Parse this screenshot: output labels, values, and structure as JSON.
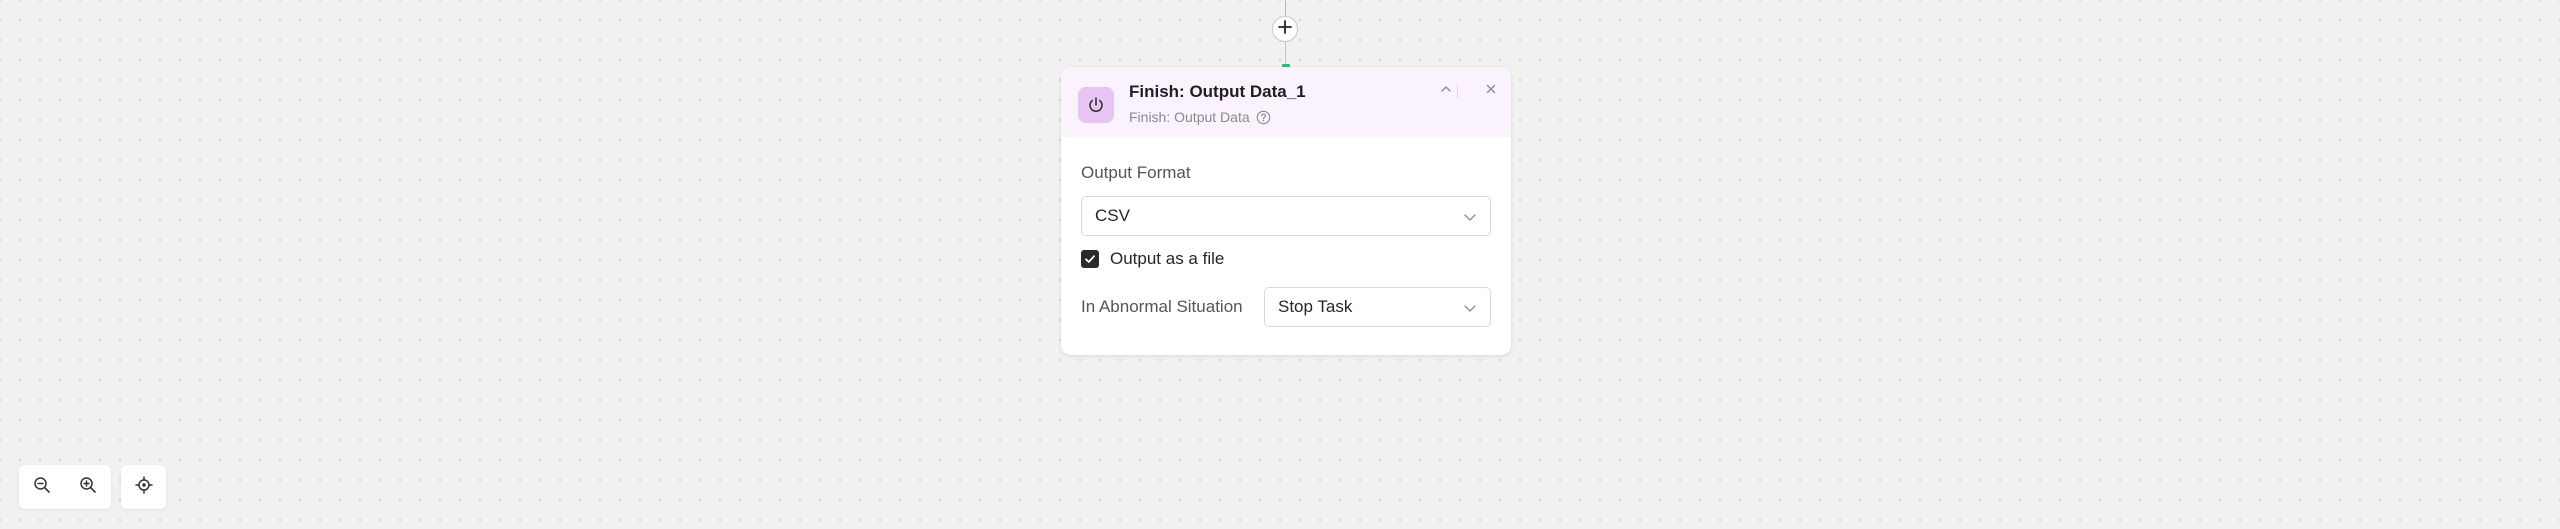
{
  "node": {
    "title": "Finish: Output Data_1",
    "subtitle": "Finish: Output Data",
    "icon": "power-icon",
    "accent_color": "#e7c4f3",
    "header_bg": "#faf3fd"
  },
  "form": {
    "output_format_label": "Output Format",
    "output_format_value": "CSV",
    "output_as_file_label": "Output as a file",
    "output_as_file_checked": true,
    "abnormal_label": "In Abnormal Situation",
    "abnormal_value": "Stop Task"
  },
  "connector": {
    "add_icon": "plus-icon",
    "active_color": "#2fbf71"
  },
  "controls": {
    "zoom_out_icon": "zoom-out-icon",
    "zoom_in_icon": "zoom-in-icon",
    "locate_icon": "locate-icon"
  }
}
